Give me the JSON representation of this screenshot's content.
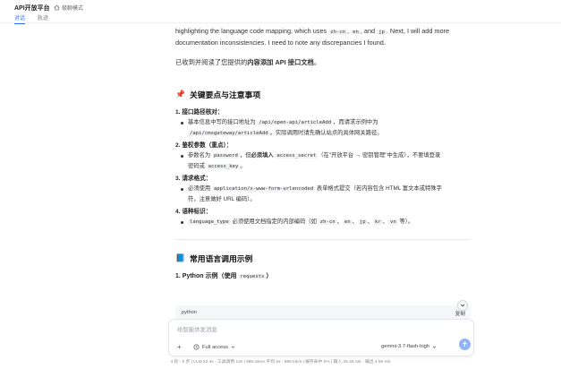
{
  "app": {
    "title": "API开放平台",
    "mode_label": "极聊模式"
  },
  "tabs": [
    {
      "label": "对话",
      "active": true
    },
    {
      "label": "轨迹",
      "active": false
    }
  ],
  "message": {
    "intro": {
      "t1": "highlighting the language code mapping, which uses ",
      "c1": "zh-cn",
      "t2": ", ",
      "c2": "en",
      "t3": ", and ",
      "c3": "jp",
      "t4": ". Next, I will add more documentation inconsistencies. I need to note any discrepancies I found."
    },
    "received": {
      "prefix": "已收到并阅读了您提供的",
      "bold": "内容添加 API 接口文档",
      "suffix": "。"
    },
    "section1": {
      "icon": "📌",
      "title": "关键要点与注意事项",
      "items": [
        {
          "label": "1. 接口路径核对：",
          "bullets": [
            {
              "a": "基本信息中写的接口地址为 ",
              "code1": "/api/open-api/articleAdd",
              "b": "，而请求示例中为"
            },
            {
              "code2": "/api/cmsgateway/articleAdd",
              "c": "。实际调用时请先确认站点的具体网关路径。"
            }
          ]
        },
        {
          "label": "2. 鉴权参数（重点）：",
          "bullets": [
            {
              "a": "参数名为 ",
              "code1": "password",
              "b": "，但",
              "bold": "必须填入",
              "code2": "access_secret",
              "c": "（在\"开放平台 → 密钥管理\"中生成），不要填登录"
            },
            {
              "a": "密码或 ",
              "code1": "access_key",
              "b": "。"
            }
          ]
        },
        {
          "label": "3. 请求格式：",
          "bullets": [
            {
              "a": "必须使用 ",
              "code1": "application/x-www-form-urlencoded",
              "b": " 表单格式提交（若内容包含 HTML 富文本或特殊字"
            },
            {
              "a": "符，注意做好 URL 编码）。"
            }
          ]
        },
        {
          "label": "4. 语种标识：",
          "bullets": [
            {
              "code1": "language_type",
              "a": " 必须使用文档指定的内部编码（如 ",
              "c1": "zh-cn",
              "s1": "、",
              "c2": "en",
              "s2": "、",
              "c3": "jp",
              "s3": "、",
              "c4": "kr",
              "s4": "、",
              "c5": "vn",
              "b": " 等）。"
            }
          ]
        }
      ]
    },
    "section2": {
      "icon": "📘",
      "title": "常用语言调用示例",
      "sub_prefix": "1. Python 示例（使用 ",
      "sub_code": "requests",
      "sub_suffix": "）",
      "code_lang": "python",
      "copy_label": "复制"
    }
  },
  "composer": {
    "placeholder": "给智能体发消息",
    "access_label": "Full access",
    "model_label": "gemini-3.7-flash-high"
  },
  "status_bar": "4 轮 - 5 步 | LLM 22.4s - 工具调用 13s | 598 token 平均 5s - 598 tok/s | 缓存命中 0% | 输入 25.4K tok · 输出 4.5K tok",
  "colors": {
    "accent": "#2f6fed",
    "send": "#93b4f2"
  }
}
